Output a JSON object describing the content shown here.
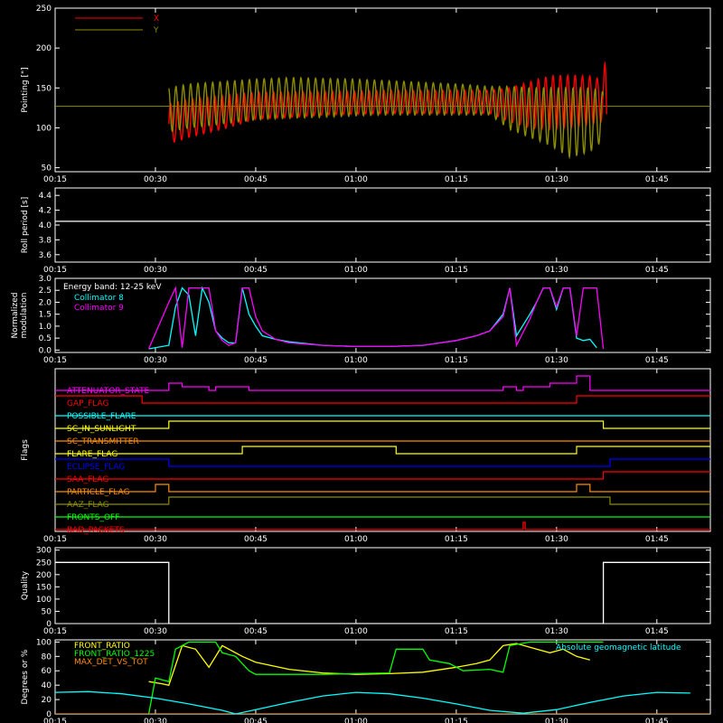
{
  "chart_data": [
    {
      "type": "line",
      "panel": "pointing",
      "ylabel": "Pointing [\"]",
      "x_ticks": [
        "00:15",
        "00:30",
        "00:45",
        "01:00",
        "01:15",
        "01:30",
        "01:45"
      ],
      "y_ticks": [
        "50",
        "100",
        "150",
        "200",
        "250"
      ],
      "ylim": [
        45,
        250
      ],
      "legend": "top-left",
      "reference_level": 127,
      "series": [
        {
          "name": "X",
          "color": "#ff0000",
          "x": [
            "00:32",
            "00:35",
            "00:40",
            "00:45",
            "00:50",
            "00:55",
            "01:00",
            "01:05",
            "01:10",
            "01:15",
            "01:20",
            "01:23",
            "01:26",
            "01:29",
            "01:32",
            "01:35",
            "01:37",
            "01:37.5"
          ],
          "upper": [
            130,
            136,
            141,
            145,
            145,
            146,
            146,
            147,
            147,
            147,
            147,
            150,
            158,
            165,
            166,
            165,
            160,
            210
          ],
          "lower": [
            80,
            88,
            98,
            111,
            113,
            116,
            117,
            118,
            118,
            118,
            118,
            108,
            100,
            98,
            100,
            104,
            108,
            50
          ]
        },
        {
          "name": "Y",
          "color": "#8c8c00",
          "x": [
            "00:32",
            "00:35",
            "00:40",
            "00:45",
            "00:50",
            "00:55",
            "01:00",
            "01:05",
            "01:10",
            "01:15",
            "01:20",
            "01:23",
            "01:26",
            "01:29",
            "01:32",
            "01:35",
            "01:37"
          ],
          "upper": [
            150,
            155,
            158,
            161,
            163,
            162,
            161,
            159,
            157,
            155,
            152,
            152,
            150,
            150,
            150,
            150,
            145
          ],
          "lower": [
            95,
            100,
            105,
            110,
            112,
            113,
            115,
            116,
            116,
            116,
            116,
            98,
            88,
            78,
            63,
            70,
            85
          ]
        }
      ]
    },
    {
      "type": "line",
      "panel": "roll_period",
      "ylabel": "Roll period [s]",
      "x_ticks": [
        "00:15",
        "00:30",
        "00:45",
        "01:00",
        "01:15",
        "01:30",
        "01:45"
      ],
      "y_ticks": [
        "3.6",
        "3.8",
        "4.0",
        "4.2",
        "4.4"
      ],
      "ylim": [
        3.5,
        4.5
      ],
      "series": [
        {
          "name": "",
          "color": "#ffffff",
          "x": [
            "00:15",
            "01:53"
          ],
          "y": [
            4.05,
            4.05
          ]
        }
      ]
    },
    {
      "type": "line",
      "panel": "modulation",
      "ylabel": "Normalized modulation",
      "x_ticks": [
        "00:15",
        "00:30",
        "00:45",
        "01:00",
        "01:15",
        "01:30",
        "01:45"
      ],
      "y_ticks": [
        "0.0",
        "0.5",
        "1.0",
        "1.5",
        "2.0",
        "2.5",
        "3.0"
      ],
      "ylim": [
        -0.1,
        3.0
      ],
      "annotation": "Energy band: 12-25 keV",
      "legend": "top-left",
      "series": [
        {
          "name": "Collimator 8",
          "color": "#00ffff",
          "x": [
            "00:29",
            "00:32",
            "00:33",
            "00:34",
            "00:35",
            "00:36",
            "00:37",
            "00:38",
            "00:39",
            "00:40",
            "00:41",
            "00:42",
            "00:43",
            "00:44",
            "00:45",
            "00:46",
            "00:48",
            "00:50",
            "00:55",
            "01:00",
            "01:05",
            "01:10",
            "01:15",
            "01:18",
            "01:20",
            "01:22",
            "01:23",
            "01:24",
            "01:26",
            "01:27",
            "01:28",
            "01:29",
            "01:30",
            "01:31",
            "01:32",
            "01:33",
            "01:34",
            "01:35",
            "01:36"
          ],
          "y": [
            0.05,
            0.2,
            1.8,
            2.6,
            2.3,
            0.6,
            2.6,
            2.0,
            0.8,
            0.5,
            0.3,
            0.3,
            2.6,
            1.5,
            1.0,
            0.6,
            0.45,
            0.35,
            0.2,
            0.15,
            0.15,
            0.2,
            0.4,
            0.6,
            0.8,
            1.5,
            2.6,
            0.6,
            1.5,
            2.0,
            2.6,
            2.6,
            1.7,
            2.6,
            2.6,
            0.5,
            0.4,
            0.45,
            0.1
          ]
        },
        {
          "name": "Collimator 9",
          "color": "#ff00ff",
          "x": [
            "00:29",
            "00:32",
            "00:33",
            "00:34",
            "00:35",
            "00:36",
            "00:37",
            "00:38",
            "00:39",
            "00:40",
            "00:41",
            "00:42",
            "00:43",
            "00:44",
            "00:45",
            "00:46",
            "00:48",
            "00:50",
            "00:55",
            "01:00",
            "01:05",
            "01:10",
            "01:15",
            "01:18",
            "01:20",
            "01:22",
            "01:23",
            "01:24",
            "01:26",
            "01:27",
            "01:28",
            "01:29",
            "01:30",
            "01:31",
            "01:32",
            "01:33",
            "01:34",
            "01:35",
            "01:36",
            "01:37"
          ],
          "y": [
            0.05,
            2.0,
            2.6,
            0.1,
            2.6,
            2.6,
            2.6,
            2.6,
            0.8,
            0.4,
            0.2,
            0.3,
            2.6,
            2.6,
            1.4,
            0.8,
            0.45,
            0.3,
            0.2,
            0.15,
            0.15,
            0.2,
            0.4,
            0.6,
            0.8,
            1.4,
            2.6,
            0.2,
            1.3,
            2.0,
            2.6,
            2.6,
            1.8,
            2.6,
            2.6,
            0.6,
            2.6,
            2.6,
            2.6,
            0.05
          ]
        }
      ]
    },
    {
      "type": "line",
      "panel": "flags",
      "ylabel": "Flags",
      "x_ticks": [
        "00:15",
        "00:30",
        "00:45",
        "01:00",
        "01:15",
        "01:30",
        "01:45"
      ],
      "flags": [
        {
          "name": "ATTENUATOR_STATE",
          "color": "#ff00ff",
          "segments": [
            [
              "00:15",
              0
            ],
            [
              "00:32",
              1
            ],
            [
              "00:34",
              0.5
            ],
            [
              "00:38",
              0
            ],
            [
              "00:39",
              0.5
            ],
            [
              "00:44",
              0
            ],
            [
              "01:22",
              0.5
            ],
            [
              "01:24",
              0
            ],
            [
              "01:25",
              0.5
            ],
            [
              "01:29",
              1
            ],
            [
              "01:33",
              2
            ],
            [
              "01:35",
              0
            ],
            [
              "01:53",
              0
            ]
          ]
        },
        {
          "name": "GAP_FLAG",
          "color": "#ff0000",
          "segments": [
            [
              "00:15",
              1
            ],
            [
              "00:28",
              0
            ],
            [
              "01:33",
              1
            ],
            [
              "01:53",
              1
            ]
          ]
        },
        {
          "name": "POSSIBLE_FLARE",
          "color": "#00ffff",
          "segments": [
            [
              "00:15",
              0
            ],
            [
              "01:53",
              0
            ]
          ]
        },
        {
          "name": "SC_IN_SUNLIGHT",
          "color": "#ffff00",
          "segments": [
            [
              "00:15",
              0
            ],
            [
              "00:32",
              1
            ],
            [
              "01:37",
              0
            ],
            [
              "01:53",
              0
            ]
          ]
        },
        {
          "name": "SC_TRANSMITTER",
          "color": "#ff8c00",
          "segments": [
            [
              "00:15",
              0
            ],
            [
              "01:53",
              0
            ]
          ]
        },
        {
          "name": "FLARE_FLAG",
          "color": "#ffff00",
          "segments": [
            [
              "00:15",
              0
            ],
            [
              "00:43",
              1
            ],
            [
              "01:06",
              0
            ],
            [
              "01:33",
              1
            ],
            [
              "01:53",
              1
            ]
          ]
        },
        {
          "name": "ECLIPSE_FLAG",
          "color": "#0000ff",
          "segments": [
            [
              "00:15",
              1
            ],
            [
              "00:32",
              0
            ],
            [
              "01:38",
              1
            ],
            [
              "01:53",
              1
            ]
          ]
        },
        {
          "name": "SAA_FLAG",
          "color": "#ff0000",
          "segments": [
            [
              "00:15",
              0
            ],
            [
              "01:37",
              1
            ],
            [
              "01:53",
              1
            ]
          ]
        },
        {
          "name": "PARTICLE_FLAG",
          "color": "#ff8c00",
          "segments": [
            [
              "00:15",
              0
            ],
            [
              "00:30",
              1
            ],
            [
              "00:32",
              0
            ],
            [
              "01:33",
              1
            ],
            [
              "01:35",
              0
            ],
            [
              "01:53",
              0
            ]
          ]
        },
        {
          "name": "AAZ_FLAG",
          "color": "#8c8c00",
          "segments": [
            [
              "00:15",
              0
            ],
            [
              "00:32",
              1
            ],
            [
              "01:37",
              1
            ],
            [
              "01:38",
              0
            ],
            [
              "01:53",
              0
            ]
          ]
        },
        {
          "name": "FRONTS_OFF",
          "color": "#00ff00",
          "segments": [
            [
              "00:15",
              0
            ],
            [
              "01:53",
              0
            ]
          ]
        },
        {
          "name": "BAD_PACKETS",
          "color": "#ff0000",
          "segments": [
            [
              "00:15",
              0
            ],
            [
              "01:25",
              1
            ],
            [
              "01:25.3",
              0
            ],
            [
              "01:53",
              0
            ]
          ]
        }
      ]
    },
    {
      "type": "line",
      "panel": "quality",
      "ylabel": "Quality",
      "x_ticks": [
        "00:15",
        "00:30",
        "00:45",
        "01:00",
        "01:15",
        "01:30",
        "01:45"
      ],
      "y_ticks": [
        "0",
        "50",
        "100",
        "150",
        "200",
        "250",
        "300"
      ],
      "ylim": [
        0,
        310
      ],
      "series": [
        {
          "name": "",
          "color": "#ffffff",
          "x": [
            "00:15",
            "00:32",
            "00:32",
            "01:37",
            "01:37",
            "01:53"
          ],
          "y": [
            250,
            250,
            0,
            0,
            250,
            250
          ]
        }
      ]
    },
    {
      "type": "line",
      "panel": "ratios",
      "ylabel": "Degrees or %",
      "x_ticks": [
        "00:15",
        "00:30",
        "00:45",
        "01:00",
        "01:15",
        "01:30",
        "01:45"
      ],
      "y_ticks": [
        "0",
        "20",
        "40",
        "60",
        "80",
        "100"
      ],
      "ylim": [
        0,
        103
      ],
      "legend": "top-left",
      "series": [
        {
          "name": "FRONT_RATIO",
          "color": "#ffff00",
          "x": [
            "00:29",
            "00:31",
            "00:32",
            "00:34",
            "00:36",
            "00:38",
            "00:40",
            "00:43",
            "00:45",
            "00:50",
            "00:55",
            "01:00",
            "01:05",
            "01:10",
            "01:15",
            "01:18",
            "01:20",
            "01:22",
            "01:24",
            "01:27",
            "01:29",
            "01:31",
            "01:33",
            "01:35"
          ],
          "y": [
            45,
            42,
            40,
            95,
            90,
            65,
            95,
            80,
            72,
            62,
            57,
            55,
            56,
            58,
            65,
            70,
            75,
            95,
            98,
            90,
            85,
            90,
            80,
            75
          ]
        },
        {
          "name": "FRONT_RATIO_1225",
          "color": "#00ff00",
          "x": [
            "00:29",
            "00:30",
            "00:32",
            "00:33",
            "00:35",
            "00:36",
            "00:39",
            "00:40",
            "00:42",
            "00:44",
            "00:45",
            "00:50",
            "00:55",
            "01:00",
            "01:05",
            "01:06",
            "01:10",
            "01:11",
            "01:14",
            "01:16",
            "01:20",
            "01:22",
            "01:23",
            "01:26",
            "01:28",
            "01:37"
          ],
          "y": [
            0,
            50,
            45,
            90,
            100,
            100,
            100,
            85,
            80,
            60,
            55,
            55,
            55,
            56,
            57,
            90,
            90,
            75,
            70,
            60,
            62,
            58,
            95,
            100,
            100,
            100
          ]
        },
        {
          "name": "MAX_DET_VS_TOT",
          "color": "#ff8c00",
          "x": [
            "00:15",
            "01:53"
          ],
          "y": [
            0,
            0
          ]
        },
        {
          "name": "Absolute geomagnetic latitude",
          "color": "#00ffff",
          "x": [
            "00:15",
            "00:20",
            "00:25",
            "00:30",
            "00:35",
            "00:40",
            "00:42",
            "00:45",
            "00:50",
            "00:55",
            "01:00",
            "01:05",
            "01:10",
            "01:15",
            "01:20",
            "01:25",
            "01:30",
            "01:35",
            "01:40",
            "01:45",
            "01:50"
          ],
          "y": [
            30,
            31,
            28,
            22,
            14,
            5,
            0,
            6,
            16,
            25,
            30,
            28,
            22,
            14,
            5,
            1,
            6,
            16,
            25,
            30,
            29
          ]
        }
      ]
    }
  ]
}
